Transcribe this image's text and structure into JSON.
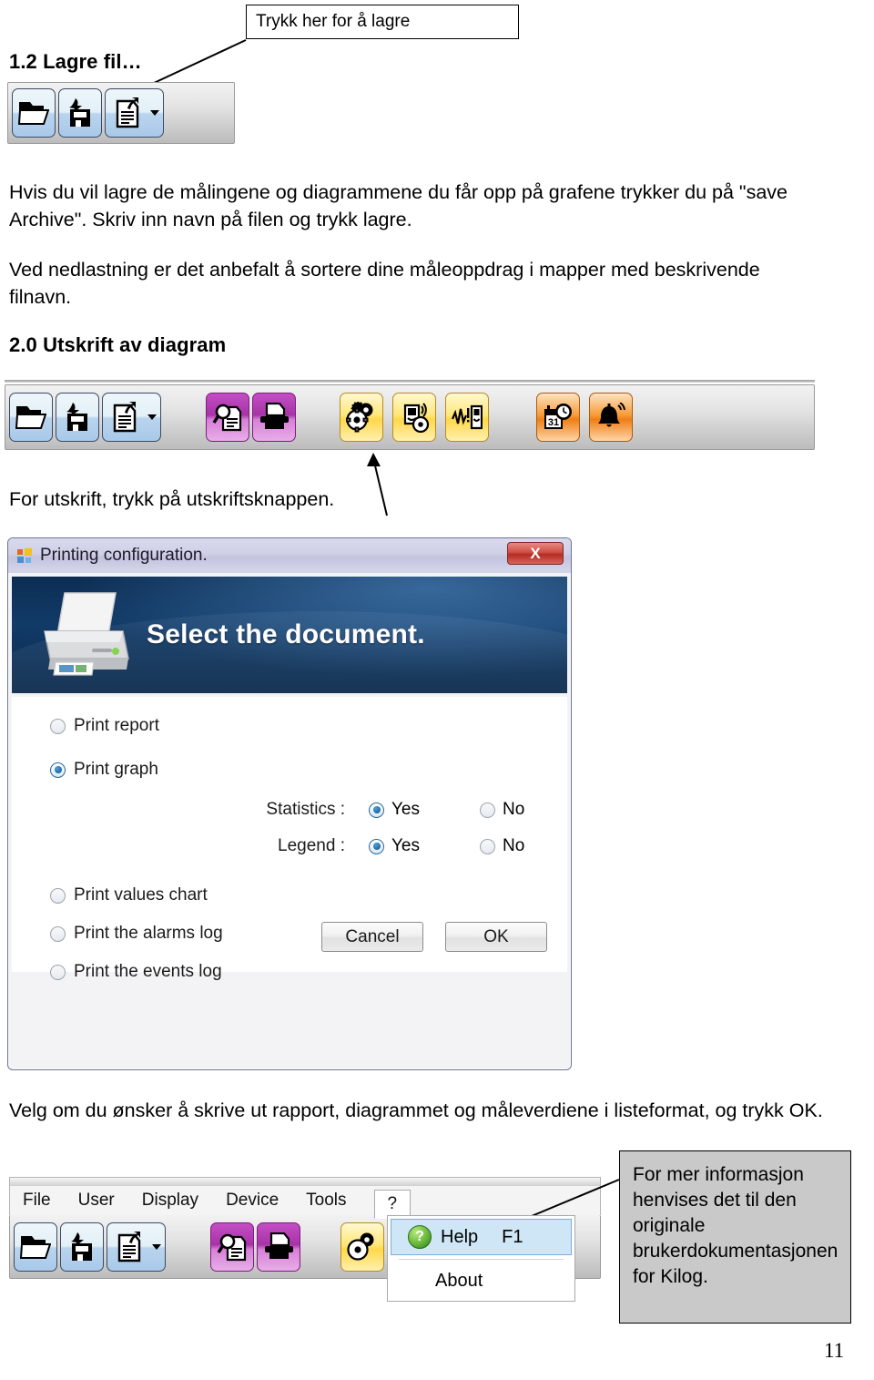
{
  "callouts": {
    "save_hint": "Trykk her for å lagre",
    "more_info": "For mer informasjon henvises det til den originale brukerdokumentasjonen for Kilog."
  },
  "sections": {
    "s1": {
      "heading": "1.2 Lagre fil…"
    },
    "s2": {
      "heading": "2.0  Utskrift av diagram"
    }
  },
  "body": {
    "p1": "Hvis du vil lagre de målingene og diagrammene du får opp på grafene trykker du på \"save Archive\". Skriv inn navn på filen og trykk lagre.",
    "p2": "Ved nedlastning er det anbefalt å sortere dine måleoppdrag i mapper med beskrivende filnavn.",
    "p3": "For utskrift, trykk på utskriftsknappen.",
    "p4": "Velg om du ønsker å skrive ut rapport, diagrammet og måleverdiene i listeformat, og trykk OK."
  },
  "toolbar_top": {
    "buttons": [
      {
        "name": "open-file",
        "icon": "folder-open-icon",
        "color": "blue"
      },
      {
        "name": "save-file",
        "icon": "floppy-save-icon",
        "color": "blue"
      },
      {
        "name": "save-archive",
        "icon": "document-export-icon",
        "color": "blue"
      }
    ],
    "has_dropdown": true
  },
  "toolbar_main": {
    "groups": [
      {
        "color": "blue",
        "buttons": [
          {
            "name": "open-file",
            "icon": "folder-open-icon"
          },
          {
            "name": "save-file",
            "icon": "floppy-save-icon"
          },
          {
            "name": "save-archive",
            "icon": "document-export-icon"
          }
        ],
        "has_dropdown": true
      },
      {
        "color": "purple",
        "buttons": [
          {
            "name": "print-preview",
            "icon": "document-magnifier-icon"
          },
          {
            "name": "print",
            "icon": "printer-icon"
          }
        ],
        "has_dropdown": false
      },
      {
        "color": "yellow",
        "buttons": [
          {
            "name": "settings",
            "icon": "gears-icon"
          },
          {
            "name": "device-config",
            "icon": "device-gear-icon"
          },
          {
            "name": "device-signal",
            "icon": "waveform-device-icon"
          }
        ],
        "has_dropdown": false
      },
      {
        "color": "orange",
        "buttons": [
          {
            "name": "schedule",
            "icon": "calendar-clock-icon"
          },
          {
            "name": "alarms",
            "icon": "bell-icon"
          }
        ],
        "has_dropdown": false
      }
    ]
  },
  "dialog": {
    "title": "Printing configuration.",
    "close_label": "X",
    "app_icon": "app-blocks-icon",
    "banner_title": "Select the document.",
    "banner_icon": "printer-illustration-icon",
    "options": [
      {
        "label": "Print report",
        "selected": false,
        "name": "print-report"
      },
      {
        "label": "Print graph",
        "selected": true,
        "name": "print-graph"
      },
      {
        "label": "Print values chart",
        "selected": false,
        "name": "print-values-chart"
      },
      {
        "label": "Print the alarms log",
        "selected": false,
        "name": "print-alarms-log"
      },
      {
        "label": "Print the events log",
        "selected": false,
        "name": "print-events-log"
      }
    ],
    "sub_options": [
      {
        "caption": "Statistics :",
        "yes": "Yes",
        "no": "No",
        "selected": "yes",
        "name": "statistics"
      },
      {
        "caption": "Legend :",
        "yes": "Yes",
        "no": "No",
        "selected": "yes",
        "name": "legend"
      }
    ],
    "buttons": {
      "cancel": "Cancel",
      "ok": "OK"
    }
  },
  "menubar": {
    "items": [
      "File",
      "User",
      "Display",
      "Device",
      "Tools",
      "?"
    ],
    "popup": {
      "help_label": "Help",
      "help_shortcut": "F1",
      "about_label": "About",
      "help_icon": "help-question-icon"
    }
  },
  "footer": {
    "page_number": "11"
  }
}
